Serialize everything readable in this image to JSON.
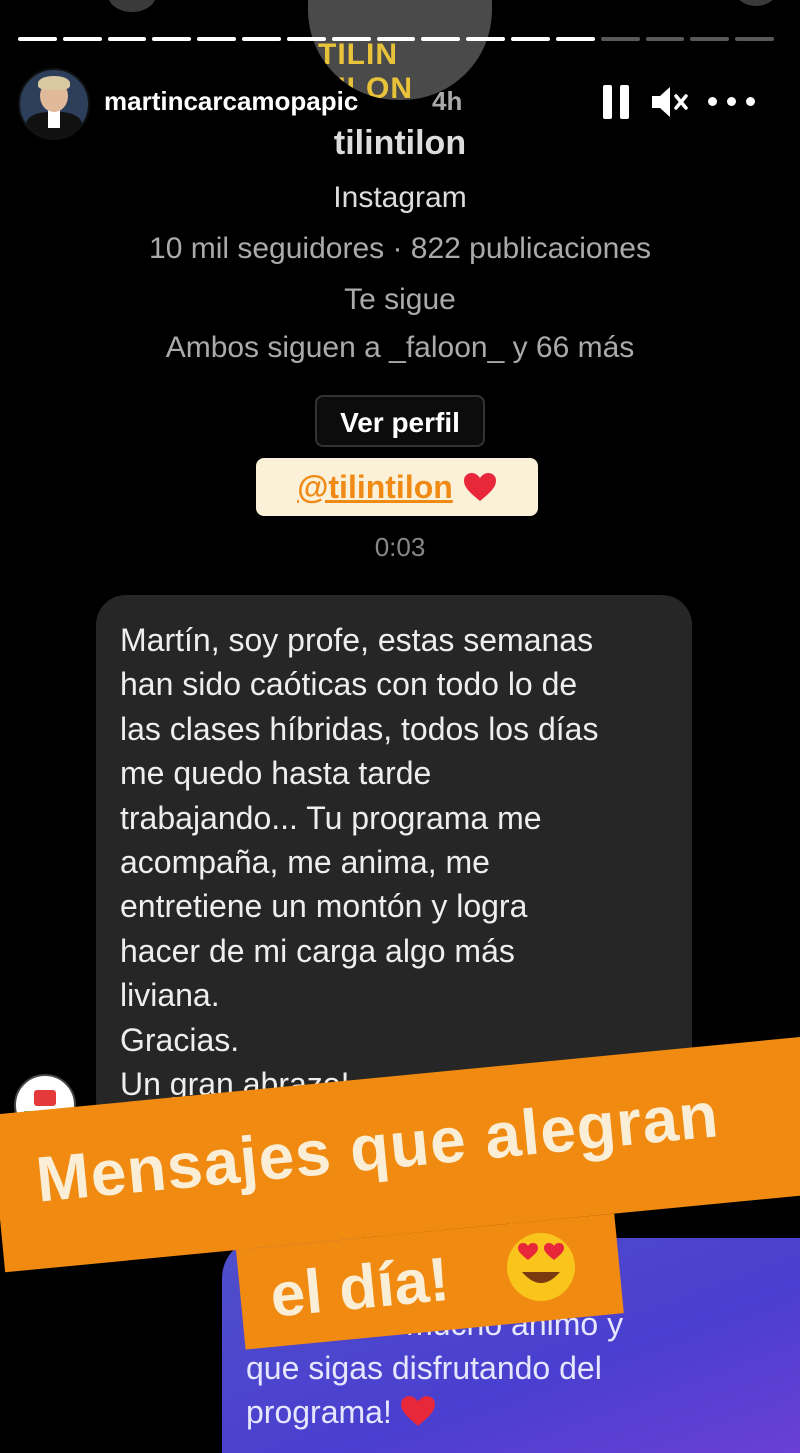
{
  "header": {
    "username": "martincarcamopapic",
    "time": "4h"
  },
  "profile": {
    "name": "tilintilon",
    "platform": "Instagram",
    "stats": "10 mil seguidores · 822 publicaciones",
    "follows": "Te sigue",
    "mutual": "Ambos siguen a _faloon_ y 66 más",
    "view_button": "Ver perfil"
  },
  "logo_text": "TILIN TILON",
  "mention": {
    "tag": "@tilintilon"
  },
  "duration": "0:03",
  "message": "Martín, soy profe, estas semanas\nhan sido caóticas con todo lo de\nlas clases híbridas, todos los días\nme quedo hasta tarde\ntrabajando... Tu programa me\nacompaña, me anima, me\nentretiene un montón y logra\nhacer de mi carga algo más\nliviana.\nGracias.\nUn gran abrazo!",
  "reply": "                      Esa es la\n         ando mucho ánimo y\nque sigas disfrutando del\nprograma!",
  "banner": {
    "line1": "Mensajes que alegran",
    "line2": "el día!"
  },
  "progress": {
    "segments": 17,
    "completed": 13
  },
  "colors": {
    "accent": "#f08a10",
    "mention_bg": "#fbf1d9",
    "bubble": "#262626",
    "reply": "#4f4fc9"
  }
}
